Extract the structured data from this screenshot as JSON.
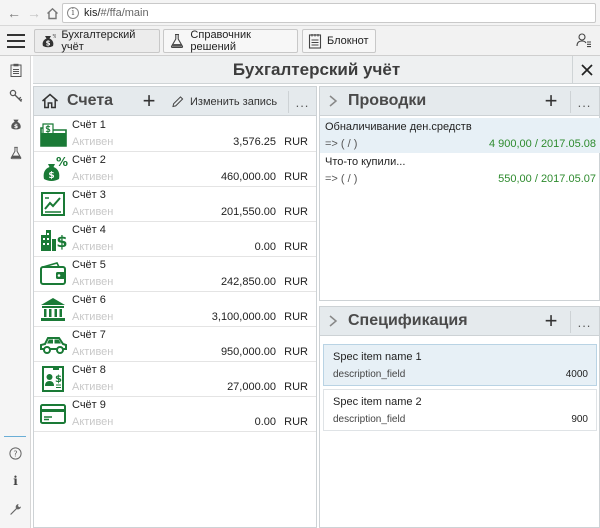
{
  "browser": {
    "url_host": "kis/",
    "url_rest": "#/ffa/main"
  },
  "top_tabs": [
    {
      "label": "Бухгалтерский учёт",
      "icon": "money-bag-icon"
    },
    {
      "label": "Справочник решений",
      "icon": "flask-icon"
    },
    {
      "label": "Блокнот",
      "icon": "notepad-icon"
    }
  ],
  "rail": {
    "items": [
      "clipboard-icon",
      "key-icon",
      "money-bag-icon",
      "flask-icon"
    ],
    "bottom": [
      "help-icon",
      "info-icon",
      "wrench-icon"
    ]
  },
  "window": {
    "title": "Бухгалтерский учёт",
    "close_label": "✕"
  },
  "accounts_panel": {
    "title": "Счета",
    "edit_label": "Изменить запись",
    "more": "...",
    "accounts": [
      {
        "name": "Счёт 1",
        "status": "Активен",
        "amount": "3,576.25",
        "currency": "RUR",
        "icon": "folder-money-icon"
      },
      {
        "name": "Счёт 2",
        "status": "Активен",
        "amount": "460,000.00",
        "currency": "RUR",
        "icon": "money-bag-percent-icon"
      },
      {
        "name": "Счёт 3",
        "status": "Активен",
        "amount": "201,550.00",
        "currency": "RUR",
        "icon": "report-chart-icon"
      },
      {
        "name": "Счёт 4",
        "status": "Активен",
        "amount": "0.00",
        "currency": "RUR",
        "icon": "city-dollar-icon"
      },
      {
        "name": "Счёт 5",
        "status": "Активен",
        "amount": "242,850.00",
        "currency": "RUR",
        "icon": "wallet-icon"
      },
      {
        "name": "Счёт 6",
        "status": "Активен",
        "amount": "3,100,000.00",
        "currency": "RUR",
        "icon": "bank-icon"
      },
      {
        "name": "Счёт 7",
        "status": "Активен",
        "amount": "950,000.00",
        "currency": "RUR",
        "icon": "car-icon"
      },
      {
        "name": "Счёт 8",
        "status": "Активен",
        "amount": "27,000.00",
        "currency": "RUR",
        "icon": "id-card-dollar-icon"
      },
      {
        "name": "Счёт 9",
        "status": "Активен",
        "amount": "0.00",
        "currency": "RUR",
        "icon": "credit-card-icon"
      }
    ]
  },
  "postings_panel": {
    "title": "Проводки",
    "more": "...",
    "items": [
      {
        "title": "Обналичивание ден.средств",
        "ref": "=> ( / )",
        "value": "4 900,00 / 2017.05.08"
      },
      {
        "title": "Что-то купили...",
        "ref": "=> ( / )",
        "value": "550,00 / 2017.05.07"
      }
    ]
  },
  "spec_panel": {
    "title": "Спецификация",
    "more": "...",
    "items": [
      {
        "name": "Spec item name 1",
        "desc": "description_field",
        "value": "4000"
      },
      {
        "name": "Spec item name 2",
        "desc": "description_field",
        "value": "900"
      }
    ]
  },
  "colors": {
    "accent_green": "#1a7a36",
    "posting_value": "#2e8b2e",
    "selected_row": "#e7f0f6",
    "header_bg": "#e5eaed"
  }
}
